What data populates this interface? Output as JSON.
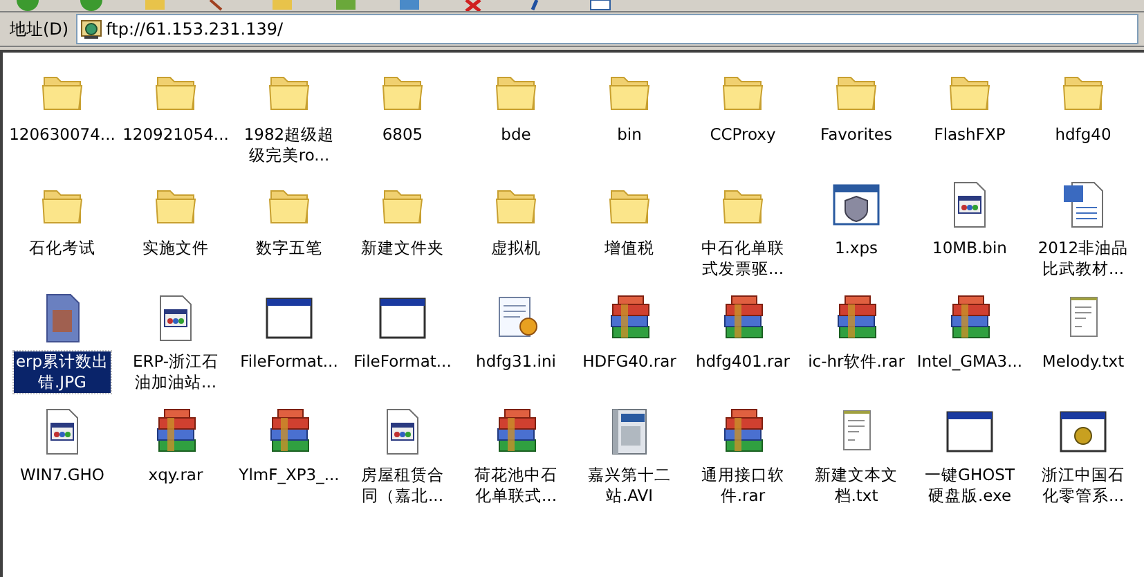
{
  "address_bar": {
    "label": "地址(D)",
    "value": "ftp://61.153.231.139/"
  },
  "items": [
    {
      "kind": "folder",
      "lines": [
        "120630074..."
      ],
      "selected": false
    },
    {
      "kind": "folder",
      "lines": [
        "120921054..."
      ],
      "selected": false
    },
    {
      "kind": "folder",
      "lines": [
        "1982超级超",
        "级完美ro..."
      ],
      "selected": false
    },
    {
      "kind": "folder",
      "lines": [
        "6805"
      ],
      "selected": false
    },
    {
      "kind": "folder",
      "lines": [
        "bde"
      ],
      "selected": false
    },
    {
      "kind": "folder",
      "lines": [
        "bin"
      ],
      "selected": false
    },
    {
      "kind": "folder",
      "lines": [
        "CCProxy"
      ],
      "selected": false
    },
    {
      "kind": "folder",
      "lines": [
        "Favorites"
      ],
      "selected": false
    },
    {
      "kind": "folder",
      "lines": [
        "FlashFXP"
      ],
      "selected": false
    },
    {
      "kind": "folder",
      "lines": [
        "hdfg40"
      ],
      "selected": false
    },
    {
      "kind": "folder",
      "lines": [
        "石化考试"
      ],
      "selected": false
    },
    {
      "kind": "folder",
      "lines": [
        "实施文件"
      ],
      "selected": false
    },
    {
      "kind": "folder",
      "lines": [
        "数字五笔"
      ],
      "selected": false
    },
    {
      "kind": "folder",
      "lines": [
        "新建文件夹"
      ],
      "selected": false
    },
    {
      "kind": "folder",
      "lines": [
        "虚拟机"
      ],
      "selected": false
    },
    {
      "kind": "folder",
      "lines": [
        "增值税"
      ],
      "selected": false
    },
    {
      "kind": "folder",
      "lines": [
        "中石化单联",
        "式发票驱..."
      ],
      "selected": false
    },
    {
      "kind": "xps",
      "lines": [
        "1.xps"
      ],
      "selected": false
    },
    {
      "kind": "generic",
      "lines": [
        "10MB.bin"
      ],
      "selected": false
    },
    {
      "kind": "word",
      "lines": [
        "2012非油品",
        "比武教材..."
      ],
      "selected": false
    },
    {
      "kind": "image",
      "lines": [
        "erp累计数出",
        "错.JPG"
      ],
      "selected": true
    },
    {
      "kind": "generic",
      "lines": [
        "ERP-浙江石",
        "油加油站..."
      ],
      "selected": false
    },
    {
      "kind": "app",
      "lines": [
        "FileFormat..."
      ],
      "selected": false
    },
    {
      "kind": "app",
      "lines": [
        "FileFormat..."
      ],
      "selected": false
    },
    {
      "kind": "ini",
      "lines": [
        "hdfg31.ini"
      ],
      "selected": false
    },
    {
      "kind": "rar",
      "lines": [
        "HDFG40.rar"
      ],
      "selected": false
    },
    {
      "kind": "rar",
      "lines": [
        "hdfg401.rar"
      ],
      "selected": false
    },
    {
      "kind": "rar",
      "lines": [
        "ic-hr软件.rar"
      ],
      "selected": false
    },
    {
      "kind": "rar",
      "lines": [
        "Intel_GMA3..."
      ],
      "selected": false
    },
    {
      "kind": "txt",
      "lines": [
        "Melody.txt"
      ],
      "selected": false
    },
    {
      "kind": "generic",
      "lines": [
        "WIN7.GHO"
      ],
      "selected": false
    },
    {
      "kind": "rar",
      "lines": [
        "xqy.rar"
      ],
      "selected": false
    },
    {
      "kind": "rar",
      "lines": [
        "YlmF_XP3_..."
      ],
      "selected": false
    },
    {
      "kind": "generic",
      "lines": [
        "房屋租赁合",
        "同（嘉北..."
      ],
      "selected": false
    },
    {
      "kind": "rar",
      "lines": [
        "荷花池中石",
        "化单联式..."
      ],
      "selected": false
    },
    {
      "kind": "avi",
      "lines": [
        "嘉兴第十二",
        "站.AVI"
      ],
      "selected": false
    },
    {
      "kind": "rar",
      "lines": [
        "通用接口软",
        "件.rar"
      ],
      "selected": false
    },
    {
      "kind": "txt",
      "lines": [
        "新建文本文",
        "档.txt"
      ],
      "selected": false
    },
    {
      "kind": "app",
      "lines": [
        "一键GHOST",
        "硬盘版.exe"
      ],
      "selected": false
    },
    {
      "kind": "setup",
      "lines": [
        "浙江中国石",
        "化零管系..."
      ],
      "selected": false
    }
  ]
}
